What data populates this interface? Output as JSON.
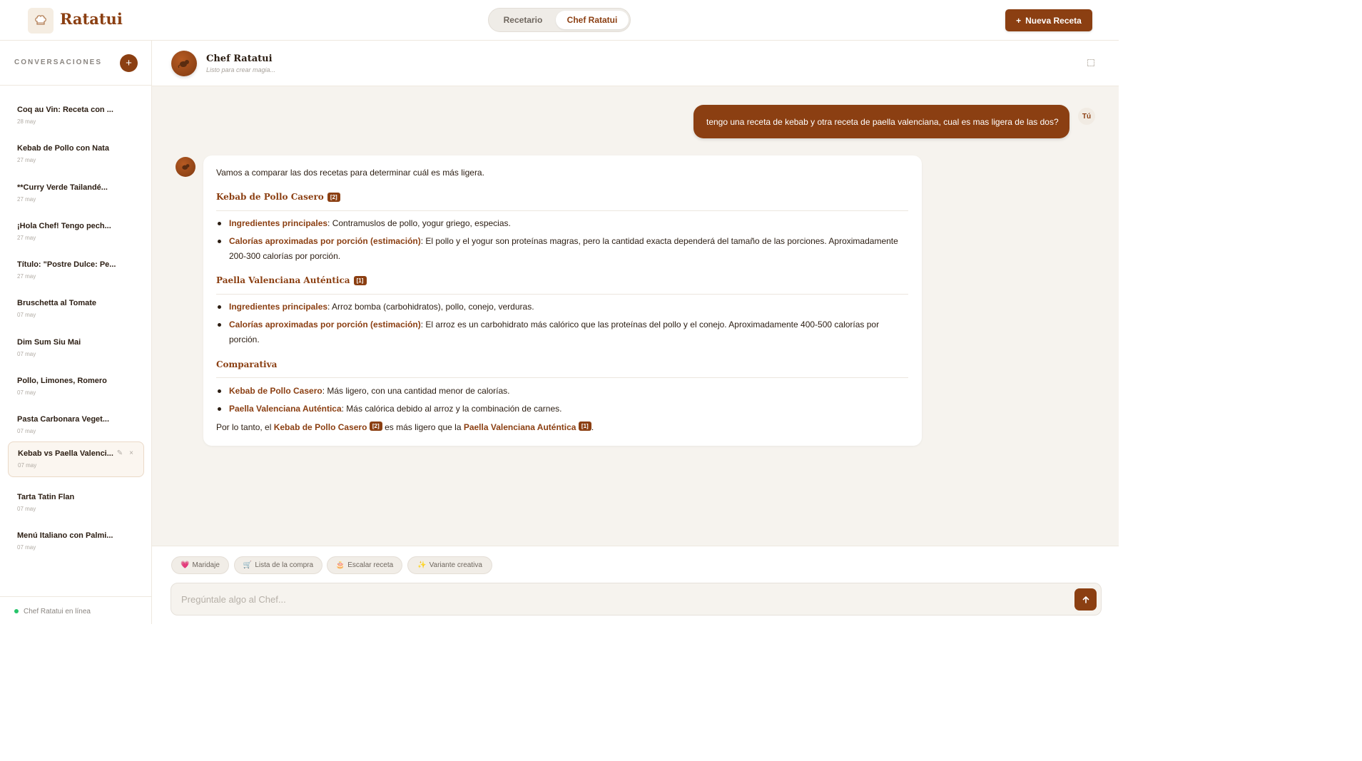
{
  "header": {
    "app_name": "Ratatui",
    "tabs": [
      {
        "label": "Recetario",
        "active": false
      },
      {
        "label": "Chef Ratatui",
        "active": true
      }
    ],
    "new_recipe_label": "Nueva Receta"
  },
  "sidebar": {
    "title": "CONVERSACIONES",
    "conversations": [
      {
        "title": "Coq au Vin: Receta con ...",
        "date": "28 may"
      },
      {
        "title": "Kebab de Pollo con Nata",
        "date": "27 may"
      },
      {
        "title": "**Curry Verde Tailandé...",
        "date": "27 may"
      },
      {
        "title": "¡Hola Chef! Tengo pech...",
        "date": "27 may"
      },
      {
        "title": "Título: \"Postre Dulce: Pe...",
        "date": "27 may"
      },
      {
        "title": "Bruschetta al Tomate",
        "date": "07 may"
      },
      {
        "title": "Dim Sum Siu Mai",
        "date": "07 may"
      },
      {
        "title": "Pollo, Limones, Romero",
        "date": "07 may"
      },
      {
        "title": "Pasta Carbonara Veget...",
        "date": "07 may"
      },
      {
        "title": "Kebab vs Paella Valenci...",
        "date": "07 may",
        "active": true
      },
      {
        "title": "Tarta Tatin Flan",
        "date": "07 may"
      },
      {
        "title": "Menú Italiano con Palmi...",
        "date": "07 may"
      }
    ],
    "status": "Chef Ratatui en línea"
  },
  "chat": {
    "name": "Chef Ratatui",
    "status": "Listo para crear magia...",
    "user_label": "Tú",
    "user_message": "tengo una receta de kebab y otra receta de paella valenciana, cual es mas ligera de las dos?",
    "response": {
      "intro": "Vamos a comparar las dos recetas para determinar cuál es más ligera.",
      "section1": {
        "title": "Kebab de Pollo Casero",
        "ref": "[2]",
        "b1_label": "Ingredientes principales",
        "b1_text": ": Contramuslos de pollo, yogur griego, especias.",
        "b2_label": "Calorías aproximadas por porción (estimación)",
        "b2_text": ": El pollo y el yogur son proteínas magras, pero la cantidad exacta dependerá del tamaño de las porciones. Aproximadamente 200-300 calorías por porción."
      },
      "section2": {
        "title": "Paella Valenciana Auténtica",
        "ref": "[1]",
        "b1_label": "Ingredientes principales",
        "b1_text": ": Arroz bomba (carbohidratos), pollo, conejo, verduras.",
        "b2_label": "Calorías aproximadas por porción (estimación)",
        "b2_text": ": El arroz es un carbohidrato más calórico que las proteínas del pollo y el conejo. Aproximadamente 400-500 calorías por porción."
      },
      "section3": {
        "title": "Comparativa",
        "b1_label": "Kebab de Pollo Casero",
        "b1_text": ": Más ligero, con una cantidad menor de calorías.",
        "b2_label": "Paella Valenciana Auténtica",
        "b2_text": ": Más calórica debido al arroz y la combinación de carnes."
      },
      "conclusion": {
        "prefix": "Por lo tanto, el ",
        "item1": "Kebab de Pollo Casero",
        "ref1": "[2]",
        "middle": " es más ligero que la ",
        "item2": "Paella Valenciana Auténtica",
        "ref2": "[1]",
        "suffix": "."
      }
    }
  },
  "composer": {
    "chips": [
      {
        "icon": "💗",
        "label": "Maridaje"
      },
      {
        "icon": "🛒",
        "label": "Lista de la compra"
      },
      {
        "icon": "🎂",
        "label": "Escalar receta"
      },
      {
        "icon": "✨",
        "label": "Variante creativa"
      }
    ],
    "placeholder": "Pregúntale algo al Chef..."
  },
  "colors": {
    "accent": "#8b3f12",
    "background": "#f6f3ee",
    "online": "#27c46a"
  }
}
